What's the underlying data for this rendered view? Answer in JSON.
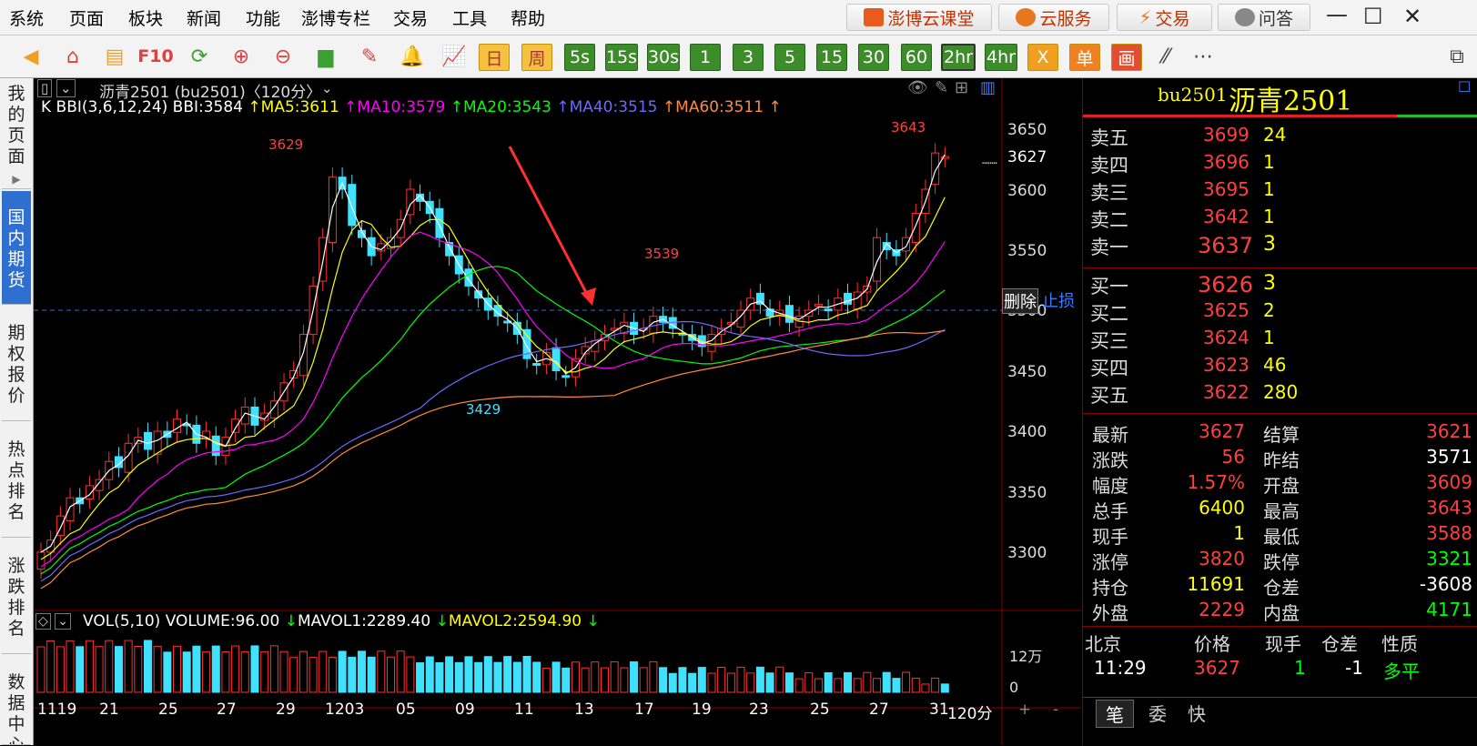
{
  "menu": [
    "系统",
    "页面",
    "板块",
    "新闻",
    "功能",
    "澎博专栏",
    "交易",
    "工具",
    "帮助"
  ],
  "top_buttons": [
    "澎博云课堂",
    "云服务",
    "交易",
    "问答"
  ],
  "toolbar_periods": [
    "日",
    "周",
    "5s",
    "15s",
    "30s",
    "1",
    "3",
    "5",
    "15",
    "30",
    "60",
    "2hr",
    "4hr",
    "X",
    "单",
    "画"
  ],
  "toolbar_text_icon": "F10",
  "sidebar_tabs": [
    "我的页面",
    "国内期货",
    "期权报价",
    "热点排名",
    "涨跌排名",
    "数据中心"
  ],
  "chart": {
    "header": "沥青2501 (bu2501)〈120分〉",
    "indicator_prefix": "K BBI(3,6,12,24) BBI:3584",
    "ma_labels": [
      {
        "text": "MA5:3611",
        "color": "#ffff00"
      },
      {
        "text": "MA10:3579",
        "color": "#ff00ff"
      },
      {
        "text": "MA20:3543",
        "color": "#00ff00"
      },
      {
        "text": "MA40:3515",
        "color": "#6a6aff"
      },
      {
        "text": "MA60:3511",
        "color": "#ff8a3d"
      }
    ],
    "price_ticks": [
      "3650",
      "3627",
      "3600",
      "3550",
      "3500",
      "3450",
      "3400",
      "3350",
      "3300"
    ],
    "annotations": {
      "high": "3643",
      "peak1": "3629",
      "peak2": "3539",
      "low": "3429"
    },
    "stop_buttons": {
      "delete": "删除",
      "stoploss": "止损"
    },
    "volume_header": "VOL(5,10) VOLUME:96.00",
    "mavol1": "MAVOL1:2289.40",
    "mavol2": "MAVOL2:2594.90",
    "volume_ticks": [
      "12万",
      "0"
    ],
    "x_labels": [
      "1119",
      "21",
      "25",
      "27",
      "29",
      "1203",
      "05",
      "09",
      "11",
      "13",
      "17",
      "19",
      "23",
      "25",
      "27",
      "31"
    ],
    "period_label": "120分",
    "zoom": {
      "in": "+",
      "out": "-"
    }
  },
  "quote": {
    "code": "bu2501",
    "name": "沥青2501",
    "asks": [
      {
        "label": "卖五",
        "price": "3699",
        "vol": "24"
      },
      {
        "label": "卖四",
        "price": "3696",
        "vol": "1"
      },
      {
        "label": "卖三",
        "price": "3695",
        "vol": "1"
      },
      {
        "label": "卖二",
        "price": "3642",
        "vol": "1"
      },
      {
        "label": "卖一",
        "price": "3637",
        "vol": "3"
      }
    ],
    "bids": [
      {
        "label": "买一",
        "price": "3626",
        "vol": "3"
      },
      {
        "label": "买二",
        "price": "3625",
        "vol": "2"
      },
      {
        "label": "买三",
        "price": "3624",
        "vol": "1"
      },
      {
        "label": "买四",
        "price": "3623",
        "vol": "46"
      },
      {
        "label": "买五",
        "price": "3622",
        "vol": "280"
      }
    ],
    "stats": [
      {
        "l1": "最新",
        "v1": "3627",
        "c1": "#ff4040",
        "l2": "结算",
        "v2": "3621",
        "c2": "#ff4040"
      },
      {
        "l1": "涨跌",
        "v1": "56",
        "c1": "#ff4040",
        "l2": "昨结",
        "v2": "3571",
        "c2": "#ffffff"
      },
      {
        "l1": "幅度",
        "v1": "1.57%",
        "c1": "#ff4040",
        "l2": "开盘",
        "v2": "3609",
        "c2": "#ff4040"
      },
      {
        "l1": "总手",
        "v1": "6400",
        "c1": "#ffff00",
        "l2": "最高",
        "v2": "3643",
        "c2": "#ff4040"
      },
      {
        "l1": "现手",
        "v1": "1",
        "c1": "#ffff00",
        "l2": "最低",
        "v2": "3588",
        "c2": "#ff4040"
      },
      {
        "l1": "涨停",
        "v1": "3820",
        "c1": "#ff4040",
        "l2": "跌停",
        "v2": "3321",
        "c2": "#00ff00"
      },
      {
        "l1": "持仓",
        "v1": "11691",
        "c1": "#ffff00",
        "l2": "仓差",
        "v2": "-3608",
        "c2": "#ffffff"
      },
      {
        "l1": "外盘",
        "v1": "2229",
        "c1": "#ff4040",
        "l2": "内盘",
        "v2": "4171",
        "c2": "#00ff00"
      }
    ],
    "trade_header": [
      "北京",
      "价格",
      "现手",
      "仓差",
      "性质"
    ],
    "trade_row": {
      "time": "11:29",
      "price": "3627",
      "vol": "1",
      "oi": "-1",
      "nature": "多平"
    },
    "bottom_tabs": [
      "笔",
      "委",
      "快"
    ]
  }
}
